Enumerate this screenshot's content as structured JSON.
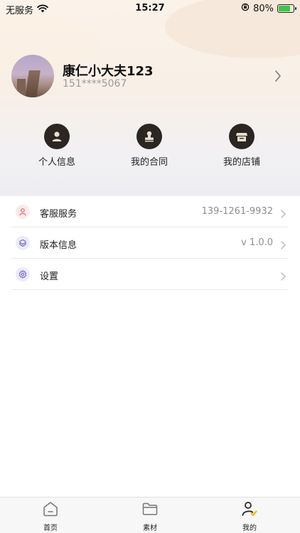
{
  "status_bar": {
    "carrier": "无服务",
    "time": "15:27",
    "battery": "80%"
  },
  "profile": {
    "name": "康仁小大夫123",
    "phone": "151****5067"
  },
  "quick_actions": [
    {
      "label": "个人信息",
      "icon": "person-icon"
    },
    {
      "label": "我的合同",
      "icon": "stamp-icon"
    },
    {
      "label": "我的店铺",
      "icon": "store-icon"
    }
  ],
  "menu": [
    {
      "label": "客服服务",
      "value": "139-1261-9932",
      "icon": "user-service-icon",
      "accent": "#e06a6a",
      "bg": "#fbe9ea"
    },
    {
      "label": "版本信息",
      "value": "v 1.0.0",
      "icon": "layers-icon",
      "accent": "#6f62c9",
      "bg": "#ecebf8"
    },
    {
      "label": "设置",
      "value": "",
      "icon": "gear-icon",
      "accent": "#6f62c9",
      "bg": "#ecebf8"
    }
  ],
  "tabs": [
    {
      "label": "首页",
      "icon": "home-icon"
    },
    {
      "label": "素材",
      "icon": "folder-icon"
    },
    {
      "label": "我的",
      "icon": "profile-icon"
    }
  ],
  "colors": {
    "battery_green": "#3cc449",
    "icon_dark": "#2b2622",
    "tab_active_accent": "#f2b705"
  }
}
